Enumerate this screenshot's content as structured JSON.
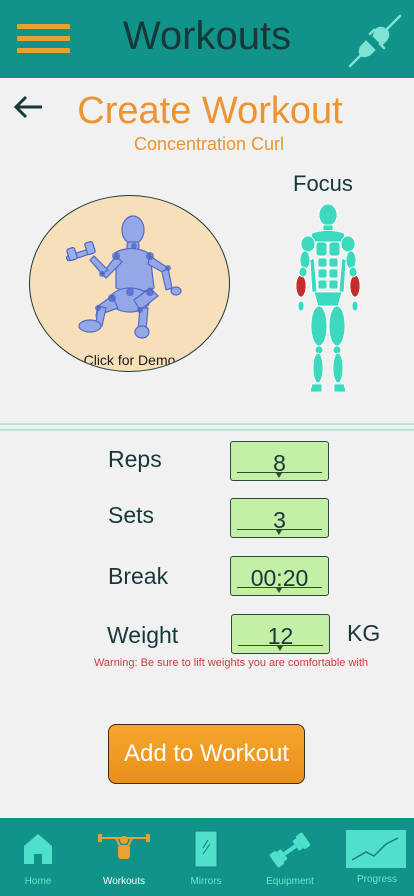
{
  "header": {
    "title": "Workouts",
    "menu_icon": "hamburger-menu-icon",
    "action_icon": "plug-icon",
    "accent": "#eba132",
    "background": "#11938a"
  },
  "page": {
    "title": "Create Workout",
    "subtitle": "Concentration Curl",
    "demo_label": "Click for Demo",
    "focus_label": "Focus",
    "focus_muscles": [
      "left-forearm",
      "right-forearm"
    ]
  },
  "fields": {
    "reps": {
      "label": "Reps",
      "value": "8"
    },
    "sets": {
      "label": "Sets",
      "value": "3"
    },
    "break": {
      "label": "Break",
      "value": "00:20"
    },
    "weight": {
      "label": "Weight",
      "value": "12",
      "unit": "KG"
    }
  },
  "warning": "Warning: Be sure to lift weights you are comfortable with",
  "add_button": "Add to Workout",
  "nav": {
    "items": [
      {
        "label": "Home",
        "icon": "home-icon",
        "active": false
      },
      {
        "label": "Workouts",
        "icon": "weightlifter-icon",
        "active": true
      },
      {
        "label": "Mirrors",
        "icon": "mirror-icon",
        "active": false
      },
      {
        "label": "Equipment",
        "icon": "dumbbell-icon",
        "active": false
      },
      {
        "label": "Progress",
        "icon": "progress-chart-icon",
        "active": false
      }
    ]
  },
  "colors": {
    "teal": "#11938a",
    "orange": "#eb9430",
    "input_green": "#c3efa7",
    "warning_red": "#cb3d3d",
    "muscle_highlight": "#c42b2b",
    "body": "#3dd9bf"
  }
}
